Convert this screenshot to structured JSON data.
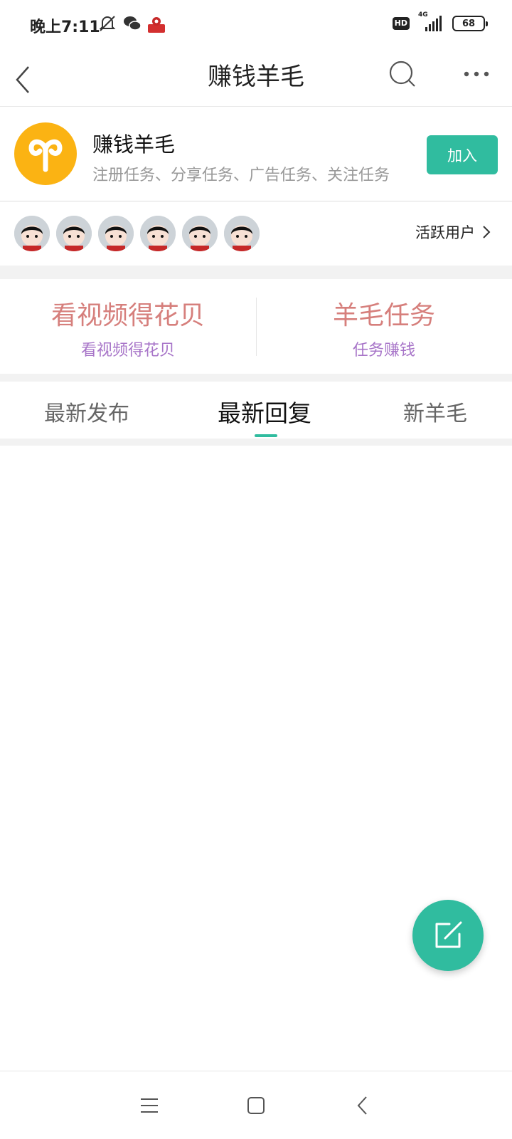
{
  "status_bar": {
    "time": "晚上7:11",
    "hd": "HD",
    "network": "4G",
    "battery": "68"
  },
  "header": {
    "title": "赚钱羊毛"
  },
  "group": {
    "name": "赚钱羊毛",
    "description": "注册任务、分享任务、广告任务、关注任务",
    "join_label": "加入",
    "avatar_color": "#fbb313"
  },
  "active_users": {
    "label": "活跃用户",
    "count": 6
  },
  "features": [
    {
      "title": "看视频得花贝",
      "subtitle": "看视频得花贝"
    },
    {
      "title": "羊毛任务",
      "subtitle": "任务赚钱"
    }
  ],
  "tabs": [
    {
      "label": "最新发布",
      "active": false
    },
    {
      "label": "最新回复",
      "active": true
    },
    {
      "label": "新羊毛",
      "active": false
    }
  ],
  "colors": {
    "accent": "#30bc9f",
    "feature_title": "#d67f7c",
    "feature_subtitle": "#a774c8"
  }
}
